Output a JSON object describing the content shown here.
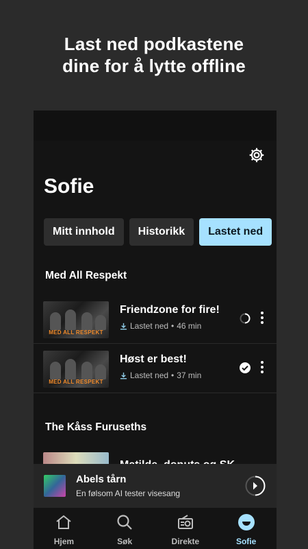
{
  "promo": {
    "line1": "Last ned podkastene",
    "line2": "dine for å lytte offline"
  },
  "profile": {
    "name": "Sofie"
  },
  "tabs": [
    {
      "label": "Mitt innhold",
      "active": false
    },
    {
      "label": "Historikk",
      "active": false
    },
    {
      "label": "Lastet ned",
      "active": true
    }
  ],
  "sections": [
    {
      "title": "Med All Respekt",
      "episodes": [
        {
          "title": "Friendzone for fire!",
          "status_text": "Lastet ned",
          "duration": "46 min",
          "status_icon": "loading-spinner-icon",
          "thumb_logo": "MED ALL RESPEKT"
        },
        {
          "title": "Høst er best!",
          "status_text": "Lastet ned",
          "duration": "37 min",
          "status_icon": "check-circle-icon",
          "thumb_logo": "MED ALL RESPEKT"
        }
      ]
    },
    {
      "title": "The Kåss Furuseths",
      "episodes": [
        {
          "title": "Matilde, donuts og SK"
        }
      ]
    }
  ],
  "miniplayer": {
    "title": "Abels tårn",
    "subtitle": "En følsom AI tester visesang"
  },
  "nav": [
    {
      "label": "Hjem",
      "icon": "home-icon",
      "active": false
    },
    {
      "label": "Søk",
      "icon": "search-icon",
      "active": false
    },
    {
      "label": "Direkte",
      "icon": "radio-icon",
      "active": false
    },
    {
      "label": "Sofie",
      "icon": "profile-icon",
      "active": true
    }
  ],
  "colors": {
    "accent": "#a6e1ff",
    "background": "#2b2b2b",
    "panel": "#141414"
  }
}
